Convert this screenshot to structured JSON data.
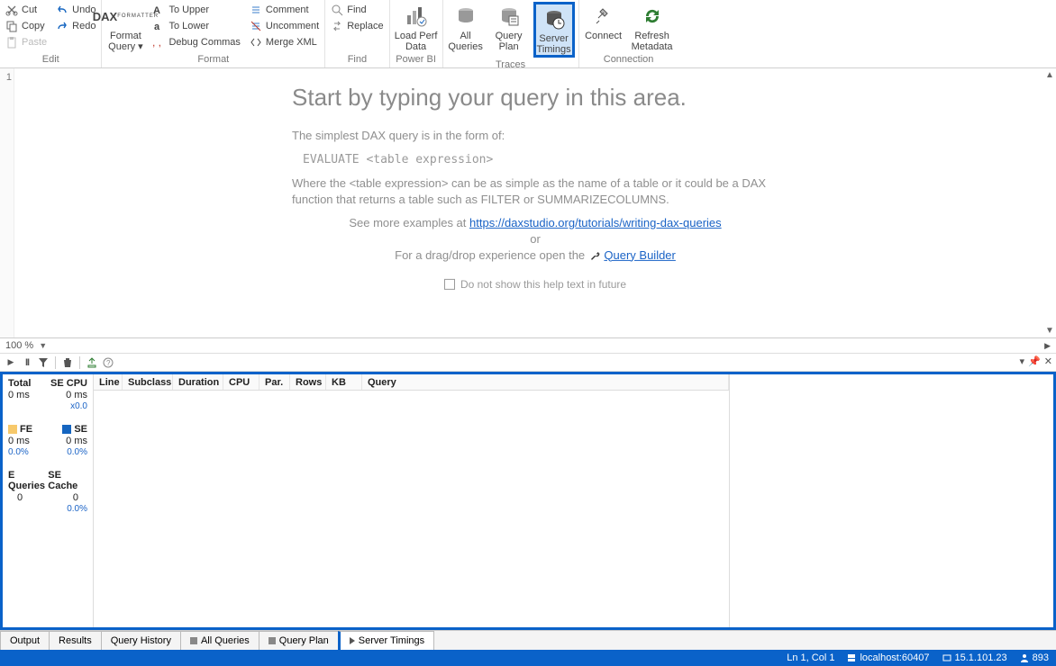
{
  "ribbon": {
    "edit": {
      "cut": "Cut",
      "copy": "Copy",
      "paste": "Paste",
      "undo": "Undo",
      "redo": "Redo",
      "label": "Edit"
    },
    "format": {
      "dax": "DAX",
      "format_query": "Format\nQuery ▾",
      "to_upper": "To Upper",
      "to_lower": "To Lower",
      "debug_commas": "Debug Commas",
      "comment": "Comment",
      "uncomment": "Uncomment",
      "merge_xml": "Merge XML",
      "label": "Format"
    },
    "find": {
      "find": "Find",
      "replace": "Replace",
      "label": "Find"
    },
    "powerbi": {
      "load_perf": "Load Perf\nData",
      "label": "Power BI"
    },
    "traces": {
      "all_queries": "All\nQueries",
      "query_plan": "Query\nPlan",
      "server_timings": "Server\nTimings",
      "label": "Traces"
    },
    "connection": {
      "connect": "Connect",
      "refresh": "Refresh\nMetadata",
      "label": "Connection"
    }
  },
  "editor": {
    "line_no": "1",
    "title": "Start by typing your query in this area.",
    "p1": "The simplest DAX query is in the form of:",
    "code": "EVALUATE <table expression>",
    "p2": "Where the <table expression> can be as simple as the name of a table or it could be a DAX function that returns a table such as FILTER or SUMMARIZECOLUMNS.",
    "p3a": "See more examples at ",
    "link1": "https://daxstudio.org/tutorials/writing-dax-queries",
    "or": "or",
    "p4a": "For a drag/drop experience open the ",
    "link2": "Query Builder",
    "chk": "Do not show this help text in future",
    "zoom": "100 %"
  },
  "server_panel": {
    "left": {
      "total_label": "Total",
      "total_val": "0 ms",
      "secpu_label": "SE CPU",
      "secpu_val": "0 ms",
      "secpu_sub": "x0.0",
      "fe_label": "FE",
      "fe_val": "0 ms",
      "fe_pct": "0.0%",
      "se_label": "SE",
      "se_val": "0 ms",
      "se_pct": "0.0%",
      "eq_label": "E Queries",
      "eq_val": "0",
      "cache_label": "SE Cache",
      "cache_val": "0",
      "cache_pct": "0.0%"
    },
    "cols": [
      "Line",
      "Subclass",
      "Duration",
      "CPU",
      "Par.",
      "Rows",
      "KB",
      "Query"
    ]
  },
  "bottom_tabs": {
    "output": "Output",
    "results": "Results",
    "history": "Query History",
    "all_queries": "All Queries",
    "query_plan": "Query Plan",
    "server_timings": "Server Timings"
  },
  "status": {
    "pos": "Ln 1, Col 1",
    "server": "localhost:60407",
    "version": "15.1.101.23",
    "users": "893"
  }
}
